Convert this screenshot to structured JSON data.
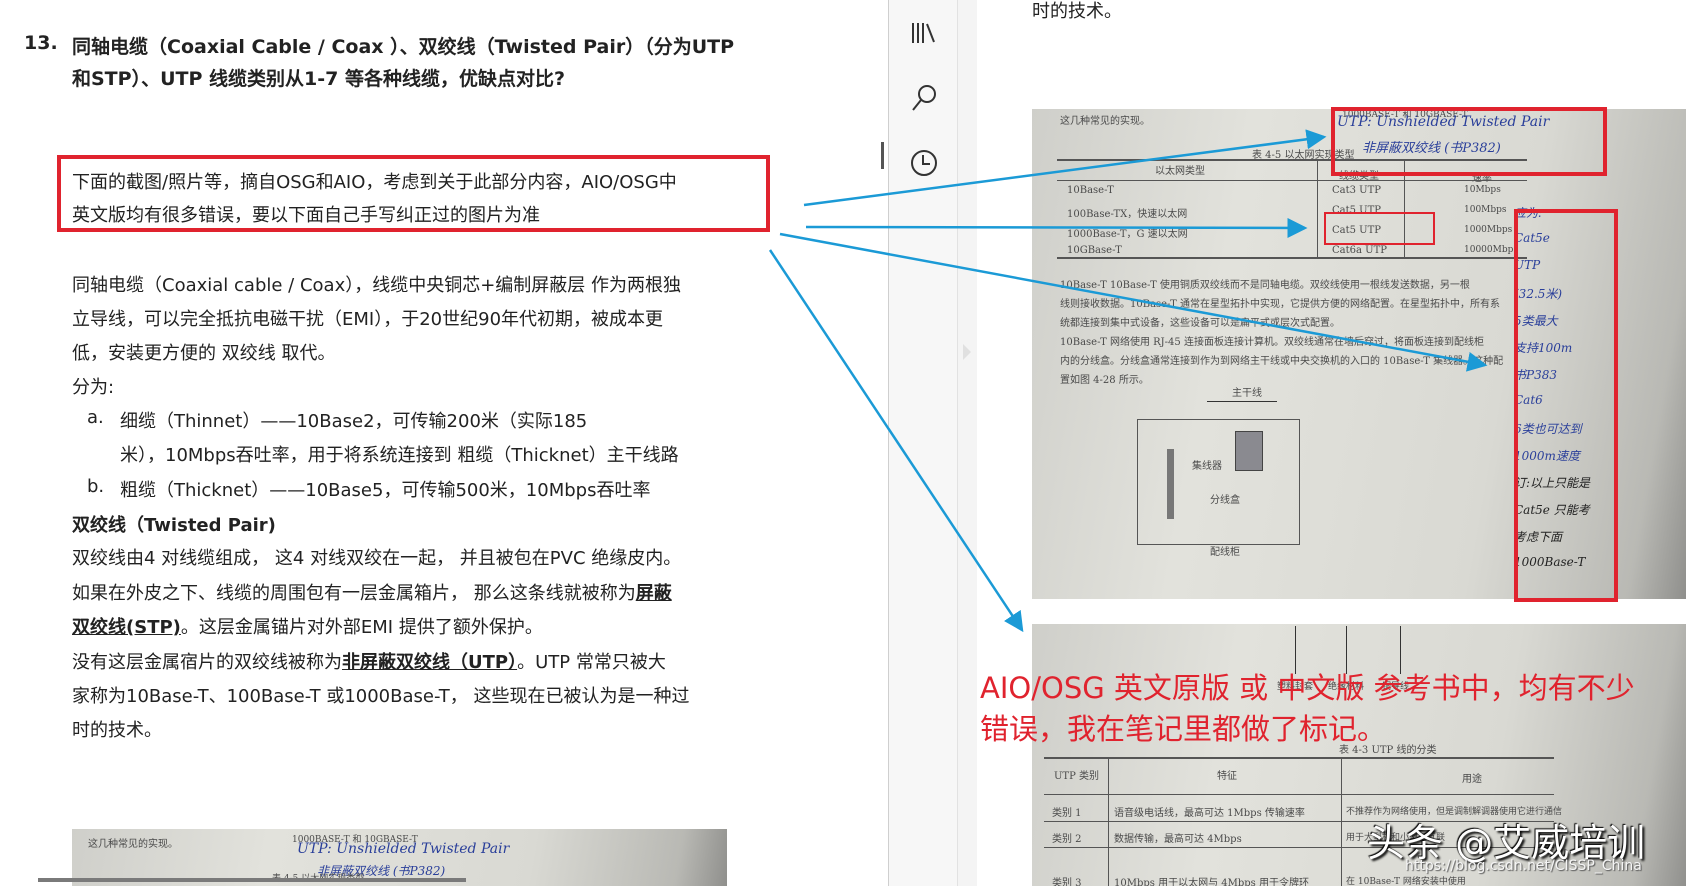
{
  "left": {
    "heading_num": "13.",
    "heading_line1": "同轴电缆（Coaxial Cable / Coax ）、双绞线（Twisted Pair）（分为UTP",
    "heading_line2": "和STP）、UTP  线缆类别从1-7   等各种线缆，优缺点对比?",
    "note_line1": "下面的截图/照片等，摘自OSG和AIO，考虑到关于此部分内容，AIO/OSG中",
    "note_line2": "英文版均有很多错误，要以下面自己手写纠正过的图片为准",
    "coax_line1": "同轴电缆（Coaxial cable / Coax），线缆中央铜芯+编制屏蔽层 作为两根独",
    "coax_line2": "立导线，可以完全抵抗电磁干扰（EMI），于20世纪90年代初期，被成本更",
    "coax_line3": "低，安装更方便的 双绞线 取代。",
    "divided": "分为:",
    "item_a_marker": "a.",
    "item_a_line1": "细缆（Thinnet）——10Base2，可传输200米（实际185",
    "item_a_line2": "米），10Mbps吞吐率，用于将系统连接到 粗缆（Thicknet）主干线路",
    "item_b_marker": "b.",
    "item_b_line1": "粗缆（Thicknet）——10Base5，可传输500米，10Mbps吞吐率",
    "tp_heading": "双绞线（Twisted Pair)",
    "tp_line1": "双绞线由4 对线缆组成， 这4 对线双绞在一起， 并且被包在PVC 绝缘皮内。",
    "tp_line2_a": "如果在外皮之下、线缆的周围包有一层金属箱片， 那么这条线就被称为",
    "tp_line2_b": "屏蔽",
    "tp_line3_a": "双绞线(STP)",
    "tp_line3_b": "。这层金属锚片对外部EMI 提供了额外保护。",
    "tp_line4_a": "没有这层金属宿片的双绞线被称为",
    "tp_line4_b": "非屏蔽双绞线（UTP）",
    "tp_line4_c": "。UTP 常常只被大",
    "tp_line5": "家称为10Base-T、100Base-T 或1000Base-T， 这些现在已被认为是一种过",
    "tp_line6": "时的技术。"
  },
  "sidebar": {
    "icons": [
      "library-icon",
      "search-icon",
      "history-icon"
    ]
  },
  "right": {
    "top_text": "时的技术。",
    "photo1": {
      "intro": "这几种常见的实现。",
      "header_top": "1000BASE-T 和 10GBASE-T",
      "caption": "表 4-5  以太网实现类型",
      "col1": "以太网类型",
      "col2": "线缆类型",
      "col3": "速率",
      "rows": [
        {
          "type": "10Base-T",
          "cable": "Cat3 UTP",
          "speed": "10Mbps"
        },
        {
          "type": "100Base-TX，快速以太网",
          "cable": "Cat5 UTP",
          "speed": "100Mbps"
        },
        {
          "type": "1000Base-T，G 速以太网",
          "cable": "Cat5 UTP",
          "speed": "1000Mbps"
        },
        {
          "type": "10GBase-T",
          "cable": "Cat6a UTP",
          "speed": "10000Mbp"
        }
      ],
      "para": [
        "10Base-T   10Base-T 使用铜质双绞线而不是同轴电缆。双绞线使用一根线发送数据，另一根",
        "线则接收数据。10Base-T 通常在星型拓扑中实现，它提供方便的网络配置。在星型拓扑中，所有系",
        "统都连接到集中式设备，这些设备可以是扁平式或层次式配置。",
        "    10Base-T 网络使用 RJ-45 连接面板连接计算机。双绞线通常在墙后穿过，将面板连接到配线柜",
        "内的分线盒。分线盒通常连接到作为到网络主干线或中央交换机的入口的 10Base-T 集线器。这种配",
        "置如图 4-28 所示。"
      ],
      "diagram_trunk": "主干线",
      "diagram_hub": "集线器",
      "diagram_box": "分线盒",
      "diagram_cabinet": "配线柜",
      "hw_top1": "UTP: Unshielded Twisted Pair",
      "hw_top2": "非屏蔽双绞线 (书P382)",
      "hw_side": [
        "应为:",
        "Cat5e",
        "UTP",
        "(32.5米)",
        "5类最大",
        "支持100m",
        "书P383",
        "Cat6",
        "6类也可达到",
        "1000m速度",
        "订:以上只能是",
        "Cat5e 只能考",
        "考虑下面",
        "1000Base-T"
      ]
    },
    "photo2": {
      "labels": [
        "塑料封套",
        "绝缘材料",
        "铜导线"
      ],
      "caption": "表 4-3  UTP 线的分类",
      "col1": "UTP 类别",
      "col2": "特征",
      "col3": "用途",
      "rows": [
        {
          "cat": "类别 1",
          "feature": "语音级电话线，最高可达 1Mbps 传输速率",
          "use": "不推荐作为网络使用，但是调制解调器使用它进行通信"
        },
        {
          "cat": "类别 2",
          "feature": "数据传输，最高可达 4Mbps",
          "use": "用于大型机和小型机互联"
        },
        {
          "cat": "类别 3",
          "feature": "10Mbps 用于以太网与 4Mbps 用于令牌环",
          "use": "在 10Base-T 网络安装中使用"
        }
      ]
    },
    "overlay_line1": "AIO/OSG 英文原版 或 中文版 参考书中，均有不少",
    "overlay_line2": "错误，我在笔记里都做了标记。",
    "watermark": "头条 @艾威培训",
    "source_url": "https://blog.csdn.net/CISSP_China"
  },
  "colors": {
    "annotation_red": "#e0232e",
    "arrow_blue": "#1b9ad6",
    "handwriting_blue": "#2a3f9a"
  }
}
